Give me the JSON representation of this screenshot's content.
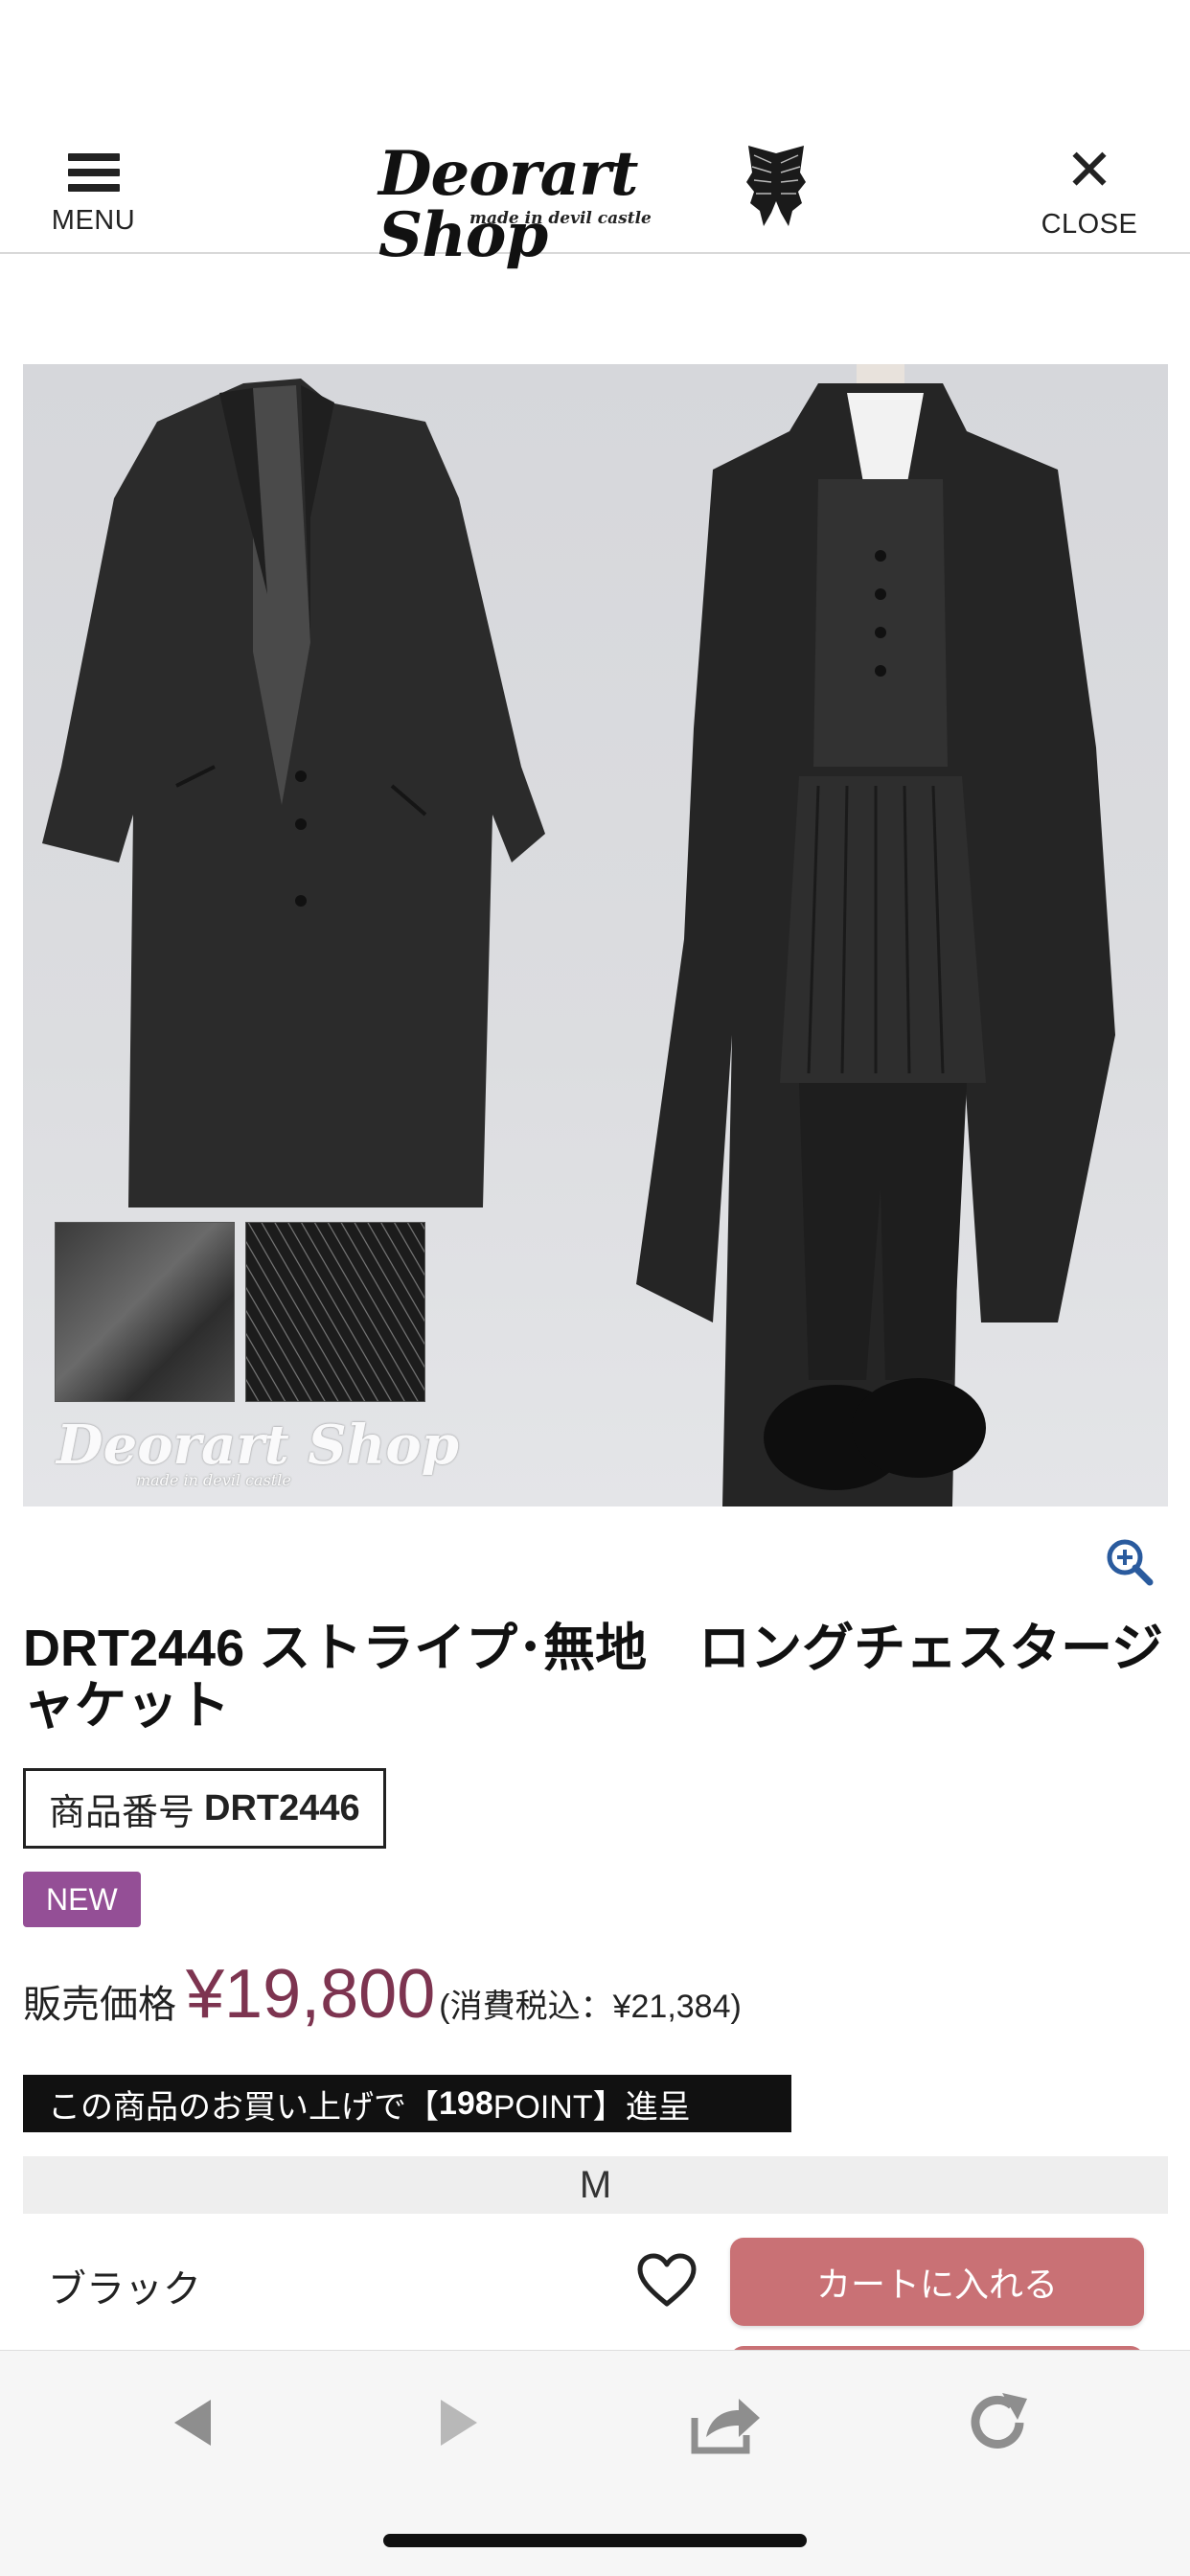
{
  "header": {
    "menu_label": "MENU",
    "close_label": "CLOSE",
    "logo_text": "Deorart Shop",
    "logo_subtext": "made in devil castle"
  },
  "product_image": {
    "watermark_text": "Deorart Shop",
    "watermark_subtext": "made in devil castle"
  },
  "product": {
    "title": "DRT2446 ストライプ･無地　ロングチェスタージャケット",
    "item_number_label": "商品番号",
    "item_number": "DRT2446",
    "badge": "NEW",
    "price_label": "販売価格",
    "price": "¥19,800",
    "price_tax": "(消費税込：¥21,384)",
    "point_prefix": "この商品のお買い上げで【",
    "point_value": "198",
    "point_suffix": " POINT】進呈",
    "size": "M",
    "color": "ブラック",
    "cart_button": "カートに入れる"
  },
  "colors": {
    "accent_price": "#7d3450",
    "new_badge": "#944f96",
    "cart_button": "#c97175"
  },
  "icons": {
    "menu": "hamburger-icon",
    "close": "close-icon",
    "zoom": "zoom-in-icon",
    "favorite": "heart-icon",
    "back": "back-arrow-icon",
    "forward": "forward-arrow-icon",
    "share": "share-icon",
    "reload": "reload-icon"
  }
}
